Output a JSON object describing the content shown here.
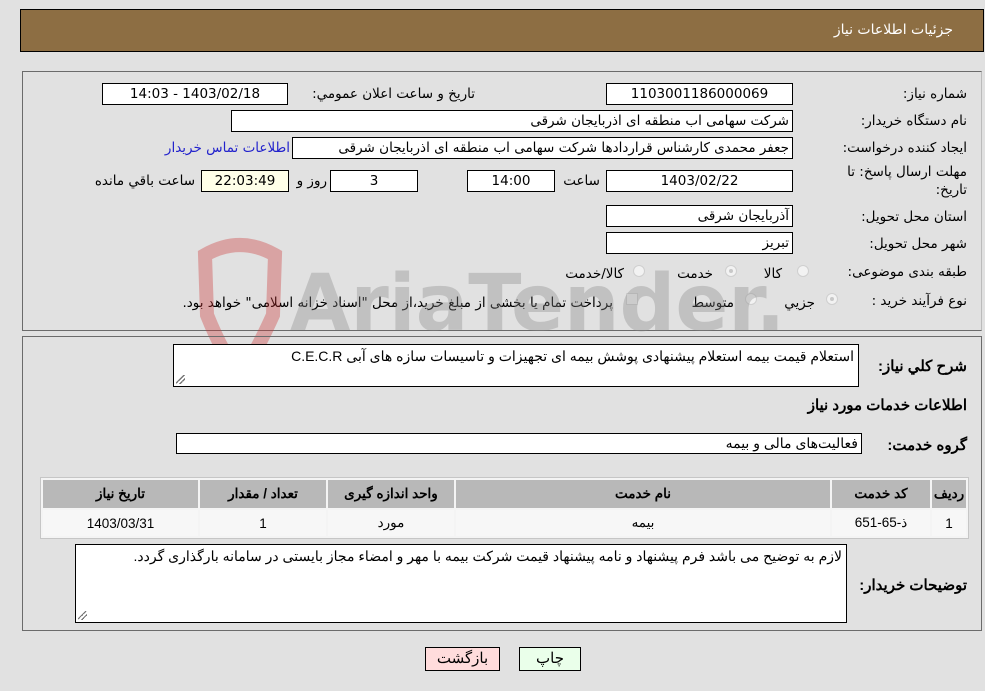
{
  "header": {
    "title": "جزئیات اطلاعات نیاز"
  },
  "form": {
    "need_number": {
      "label": "شماره نیاز:",
      "value": "1103001186000069"
    },
    "announce_datetime": {
      "label": "تاریخ و ساعت اعلان عمومي:",
      "value": "1403/02/18 - 14:03"
    },
    "buyer_org": {
      "label": "نام دستگاه خريدار:",
      "value": "شرکت سهامی اب منطقه ای اذربایجان شرقی"
    },
    "requester": {
      "label": "ایجاد کننده درخواست:",
      "value": "جعفر محمدی کارشناس قراردادها شرکت سهامی اب منطقه ای اذربایجان شرقی",
      "contact_link": "اطلاعات تماس خریدار"
    },
    "deadline": {
      "label": "مهلت ارسال پاسخ: تا تاریخ:",
      "date": "1403/02/22",
      "time_label": "ساعت",
      "time": "14:00",
      "days": "3",
      "days_label": "روز و",
      "remaining": "22:03:49",
      "remaining_label": "ساعت باقي مانده"
    },
    "province": {
      "label": "استان محل تحویل:",
      "value": "آذربایجان شرقی"
    },
    "city": {
      "label": "شهر محل تحویل:",
      "value": "تبریز"
    },
    "category": {
      "label": "طبقه بندی موضوعی:",
      "options": [
        "کالا",
        "خدمت",
        "کالا/خدمت"
      ],
      "selected": "خدمت"
    },
    "purchase_type": {
      "label": "نوع فرآیند خرید :",
      "options": [
        "جزيي",
        "متوسط"
      ],
      "selected": "جزيي",
      "treasury_note": "پرداخت تمام یا بخشی از مبلغ خرید،از محل \"اسناد خزانه اسلامی\" خواهد بود."
    }
  },
  "description": {
    "label": "شرح کلي نياز:",
    "value": "استعلام قیمت بیمه استعلام  پیشنهادی پوشش بیمه ای تجهیزات و تاسیسات سازه های آبی C.E.C.R"
  },
  "services": {
    "section_title": "اطلاعات خدمات مورد نياز",
    "group_label": "گروه خدمت:",
    "group_value": "فعالیت‌های مالی و بیمه",
    "table": {
      "headers": [
        "رديف",
        "کد خدمت",
        "نام خدمت",
        "واحد اندازه گيری",
        "تعداد / مقدار",
        "تاريخ نياز"
      ],
      "rows": [
        [
          "1",
          "ذ-65-651",
          "بیمه",
          "مورد",
          "1",
          "1403/03/31"
        ]
      ]
    }
  },
  "buyer_notes": {
    "label": "توضیحات خریدار:",
    "value": "لازم به توضیح می باشد فرم پیشنهاد و نامه پیشنهاد قیمت شرکت بیمه با مهر و امضاء مجاز بایستی در سامانه بارگذاری گردد."
  },
  "buttons": {
    "print": "چاپ",
    "back": "بازگشت"
  },
  "watermark": {
    "text": "AriaTender.neT"
  }
}
